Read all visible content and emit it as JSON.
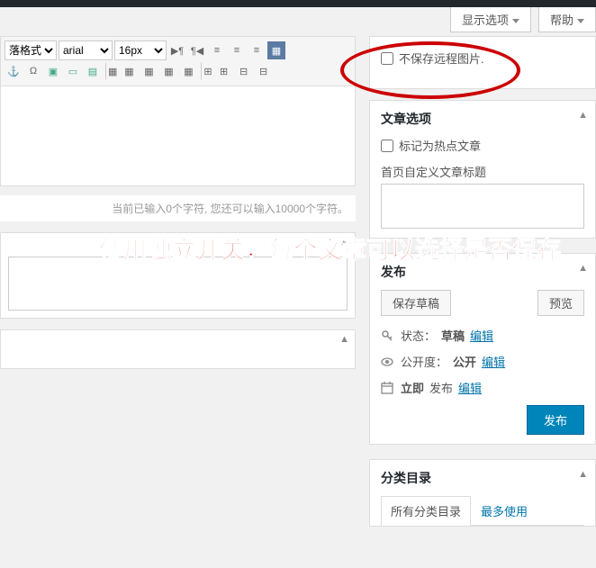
{
  "screen_options": {
    "display": "显示选项",
    "help": "帮助"
  },
  "remote_image": {
    "label": "不保存远程图片."
  },
  "post_options": {
    "title": "文章选项",
    "hot_label": "标记为热点文章",
    "custom_title_label": "首页自定义文章标题"
  },
  "editor": {
    "format_select": "落格式",
    "font_select": "arial",
    "size_select": "16px",
    "char_count": "当前已输入0个字符, 您还可以输入10000个字符。"
  },
  "overlay": "使用独立开关，每个文章可以选择是否保存",
  "publish": {
    "title": "发布",
    "save_draft": "保存草稿",
    "preview": "预览",
    "status_label": "状态：",
    "status_value": "草稿",
    "visibility_label": "公开度：",
    "visibility_value": "公开",
    "schedule_label": "立即",
    "schedule_suffix": "发布",
    "edit": "编辑",
    "submit": "发布"
  },
  "categories": {
    "title": "分类目录",
    "tab_all": "所有分类目录",
    "tab_most": "最多使用"
  }
}
